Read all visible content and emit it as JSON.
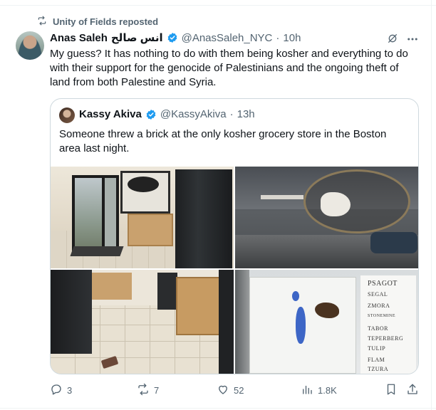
{
  "repost_label": "Unity of Fields reposted",
  "tweet": {
    "name": "Anas Saleh",
    "name_arabic": "انس صالح",
    "handle": "@AnasSaleh_NYC",
    "separator": "·",
    "time": "10h",
    "text": "My guess? It has nothing to do with them being kosher and everything to do with their support for the genocide of Palestinians and the ongoing theft of land from both Palestine and Syria."
  },
  "quote": {
    "name": "Kassy Akiva",
    "handle": "@KassyAkiva",
    "separator": "·",
    "time": "13h",
    "text": "Someone threw a brick at the only kosher grocery store in the Boston area last night.",
    "map_list": [
      "PSAGOT",
      "SEGAL",
      "ZMORA",
      "STONEMINE",
      "TABOR",
      "TEPERBERG",
      "TULIP",
      "FLAM",
      "TZURA"
    ]
  },
  "actions": {
    "replies": "3",
    "reposts": "7",
    "likes": "52",
    "views": "1.8K"
  },
  "colors": {
    "verified": "#1d9bf0",
    "secondary_text": "#536471",
    "border": "#cfd9de"
  },
  "icons": [
    "repost-icon",
    "verified-icon",
    "grok-icon",
    "more-icon",
    "reply-icon",
    "like-icon",
    "views-icon",
    "bookmark-icon",
    "share-icon"
  ]
}
